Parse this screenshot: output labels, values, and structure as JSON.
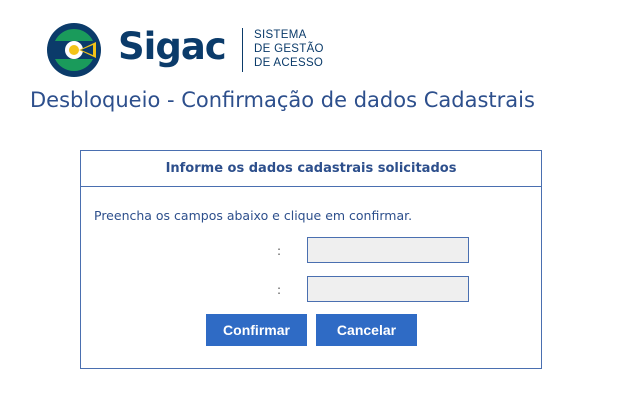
{
  "brand": {
    "logo_icon": "sigac-logo-icon",
    "name": "Sigac",
    "tagline": [
      "SISTEMA",
      "DE GESTÃO",
      "DE ACESSO"
    ],
    "colors": {
      "navy": "#0b3b6a",
      "green": "#1a9b5b",
      "yellow": "#f2c318",
      "blue": "#2f6bc5"
    }
  },
  "page": {
    "title": "Desbloqueio - Confirmação de dados Cadastrais"
  },
  "form": {
    "header": "Informe os dados cadastrais solicitados",
    "instruction": "Preencha os campos abaixo e clique em confirmar.",
    "fields": [
      {
        "label": ":",
        "value": "",
        "placeholder": ""
      },
      {
        "label": ":",
        "value": "",
        "placeholder": ""
      }
    ],
    "confirm_label": "Confirmar",
    "cancel_label": "Cancelar"
  }
}
